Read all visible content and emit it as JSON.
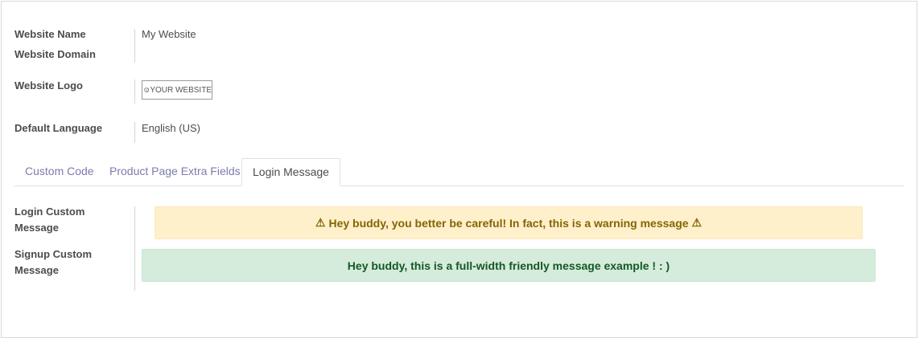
{
  "fields": {
    "website_name_label": "Website Name",
    "website_name_value": "My Website",
    "website_domain_label": "Website Domain",
    "website_domain_value": "",
    "website_logo_label": "Website Logo",
    "website_logo_text": "YOUR WEBSITE",
    "default_language_label": "Default Language",
    "default_language_value": "English (US)"
  },
  "tabs": [
    {
      "label": "Custom Code",
      "active": false
    },
    {
      "label": "Product Page Extra Fields",
      "active": false
    },
    {
      "label": "Login Message",
      "active": true
    }
  ],
  "login_tab": {
    "login_label_line1": "Login Custom",
    "login_label_line2": "Message",
    "signup_label_line1": "Signup Custom",
    "signup_label_line2": "Message",
    "warning_message": "Hey buddy, you better be careful! In fact, this is a warning message",
    "success_message": "Hey buddy, this is a full-width friendly message example ! : )"
  },
  "colors": {
    "tab_link": "#7c7bad",
    "warning_bg": "#fef0cb",
    "warning_text": "#856404",
    "success_bg": "#d5ecdc",
    "success_text": "#155724"
  },
  "icons": {
    "warning": "warning-triangle-icon",
    "logo": "globe-icon"
  }
}
